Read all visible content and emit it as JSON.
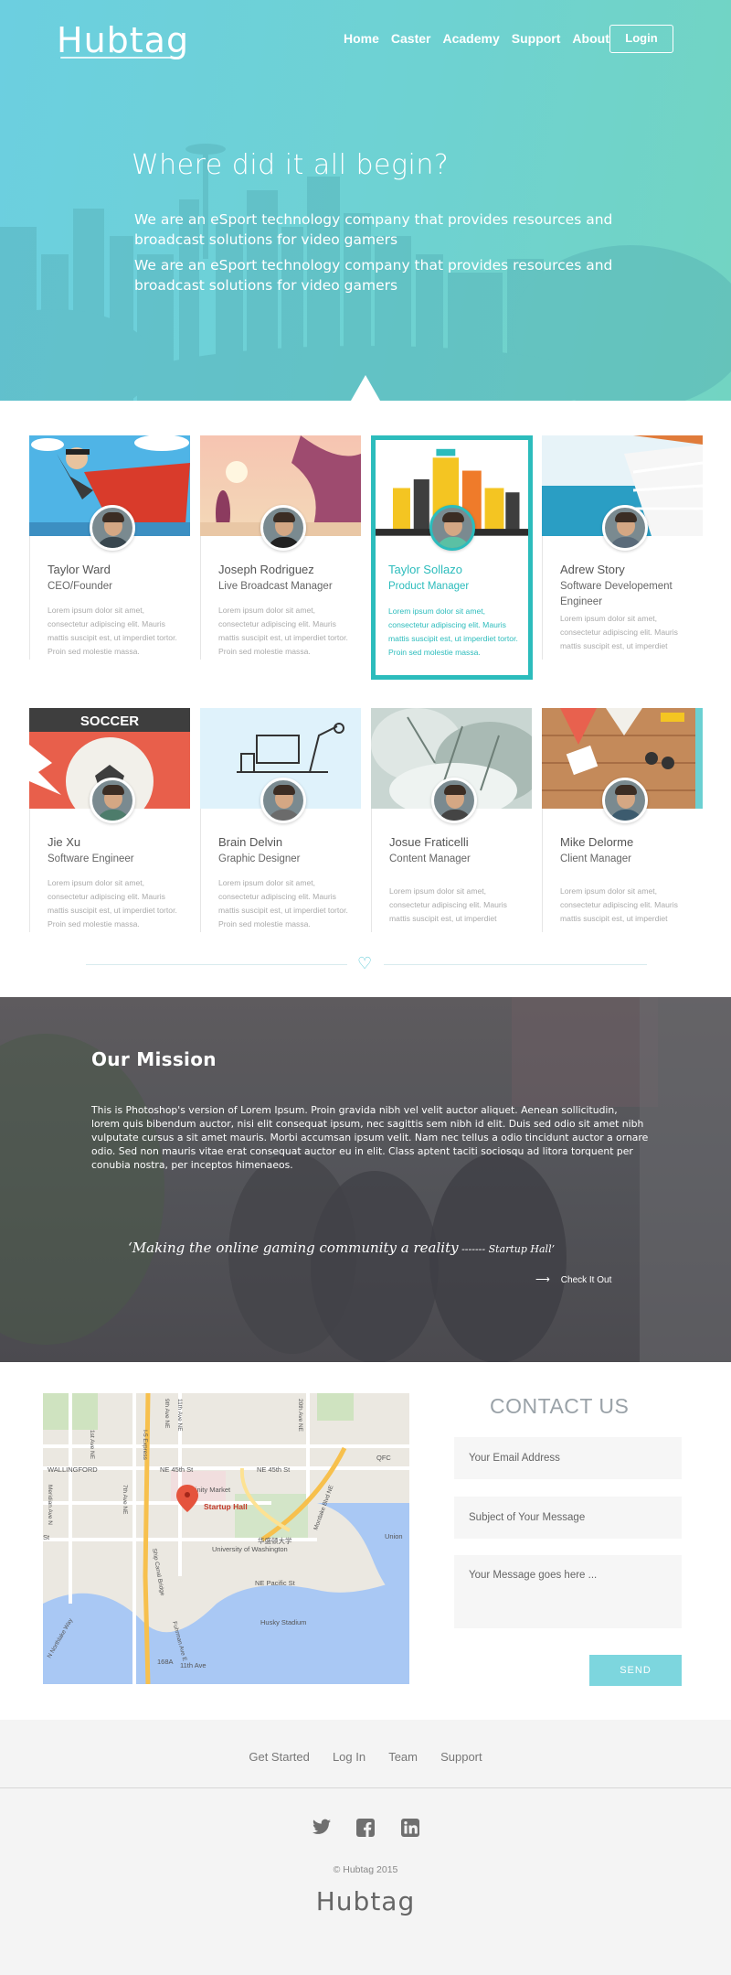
{
  "header": {
    "logo": "Hubtag",
    "nav": [
      "Home",
      "Caster",
      "Academy",
      "Support",
      "About"
    ],
    "login_label": "Login"
  },
  "hero": {
    "title": "Where did it all begin?",
    "paragraph_1": "We are an eSport technology company that provides resources and broadcast solutions for video gamers",
    "paragraph_2": "We are an eSport technology company that provides resources and broadcast solutions for video gamers"
  },
  "team": [
    {
      "name": "Taylor Ward",
      "role": "CEO/Founder",
      "desc": "Lorem ipsum dolor sit amet, consectetur adipiscing elit. Mauris mattis suscipit est, ut imperdiet tortor. Proin sed molestie massa.",
      "image": "superhero-illustration"
    },
    {
      "name": "Joseph Rodriguez",
      "role": "Live Broadcast Manager",
      "desc": "Lorem ipsum dolor sit amet, consectetur adipiscing elit. Mauris mattis suscipit est, ut imperdiet tortor. Proin sed molestie massa.",
      "image": "sunset-beach-illustration"
    },
    {
      "name": "Taylor Sollazo",
      "role": "Product Manager",
      "desc": "Lorem ipsum dolor sit amet, consectetur adipiscing elit. Mauris mattis suscipit est, ut imperdiet tortor. Proin sed molestie massa.",
      "image": "city-illustration"
    },
    {
      "name": "Adrew Story",
      "role": "Software Developement Engineer",
      "desc": "Lorem ipsum dolor sit amet, consectetur adipiscing elit. Mauris mattis suscipit est, ut imperdiet",
      "image": "ship-deck-illustration"
    },
    {
      "name": "Jie Xu",
      "role": "Software Engineer",
      "desc": "Lorem ipsum dolor sit amet, consectetur adipiscing elit. Mauris mattis suscipit est, ut imperdiet tortor. Proin sed molestie massa.",
      "image": "soccer-illustration",
      "image_text": "SOCCER"
    },
    {
      "name": "Brain Delvin",
      "role": "Graphic Designer",
      "desc": "Lorem ipsum dolor sit amet, consectetur adipiscing elit. Mauris mattis suscipit est, ut imperdiet tortor. Proin sed molestie massa.",
      "image": "desk-illustration"
    },
    {
      "name": "Josue Fraticelli",
      "role": "Content Manager",
      "desc": "Lorem ipsum dolor sit amet, consectetur adipiscing elit. Mauris mattis suscipit est, ut imperdiet",
      "image": "frosty-tree-photo"
    },
    {
      "name": "Mike Delorme",
      "role": "Client Manager",
      "desc": "Lorem ipsum dolor sit amet, consectetur adipiscing elit. Mauris mattis suscipit est, ut imperdiet",
      "image": "beach-table-illustration"
    }
  ],
  "mission": {
    "title": "Our Mission",
    "body": "This is Photoshop's version  of Lorem Ipsum. Proin gravida nibh vel velit auctor aliquet. Aenean sollicitudin, lorem quis bibendum auctor, nisi elit consequat ipsum, nec sagittis sem nibh id elit. Duis sed odio sit amet nibh vulputate cursus a sit amet mauris. Morbi accumsan ipsum velit. Nam nec tellus a odio tincidunt auctor a ornare odio. Sed non  mauris vitae erat consequat auctor eu in elit. Class aptent taciti sociosqu ad litora torquent per conubia nostra, per inceptos himenaeos.",
    "quote": "‘Making the online gaming community a reality",
    "quote_by": " ------- Startup Hall’",
    "link_label": "Check It Out"
  },
  "map": {
    "marker_label": "Startup Hall",
    "labels": {
      "wallingford": "WALLINGFORD",
      "ne45": "NE 45th St",
      "ne45b": "NE 45th St",
      "trinity": "Trinity Market",
      "uw": "University of Washington",
      "uw_cn": "华盛顿大学",
      "husky": "Husky Stadium",
      "qfc": "QFC",
      "union": "Union",
      "montlake": "Montlake Blvd NE",
      "ne_pacific": "NE Pacific St",
      "i5": "I-5 Express",
      "ship_canal": "Ship Canal Bridge",
      "northlake": "N Northlake Way",
      "eastlake": "Fuhrman Ave E",
      "ave20": "20th Ave NE",
      "ave11": "11th Ave NE",
      "ave9": "9th Ave NE",
      "ave7": "7th Ave NE",
      "ave1": "1st Ave NE",
      "meridian": "Meridian Ave N",
      "st": "St",
      "shield": "168A",
      "ave11b": "11th Ave"
    }
  },
  "contact": {
    "title": "CONTACT US",
    "email_placeholder": "Your Email Address",
    "subject_placeholder": "Subject of Your Message",
    "message_placeholder": "Your Message goes here ...",
    "send_label": "SEND"
  },
  "footer": {
    "links": [
      "Get Started",
      "Log In",
      "Team",
      "Support"
    ],
    "social": [
      "twitter-icon",
      "facebook-icon",
      "linkedin-icon"
    ],
    "copyright": "© Hubtag 2015",
    "logo": "Hubtag"
  },
  "colors": {
    "accent": "#2cbcbc",
    "hero_start": "#6ccfe0",
    "hero_end": "#72d4c2",
    "send": "#7dd6de",
    "mission_bg": "#55555a"
  }
}
